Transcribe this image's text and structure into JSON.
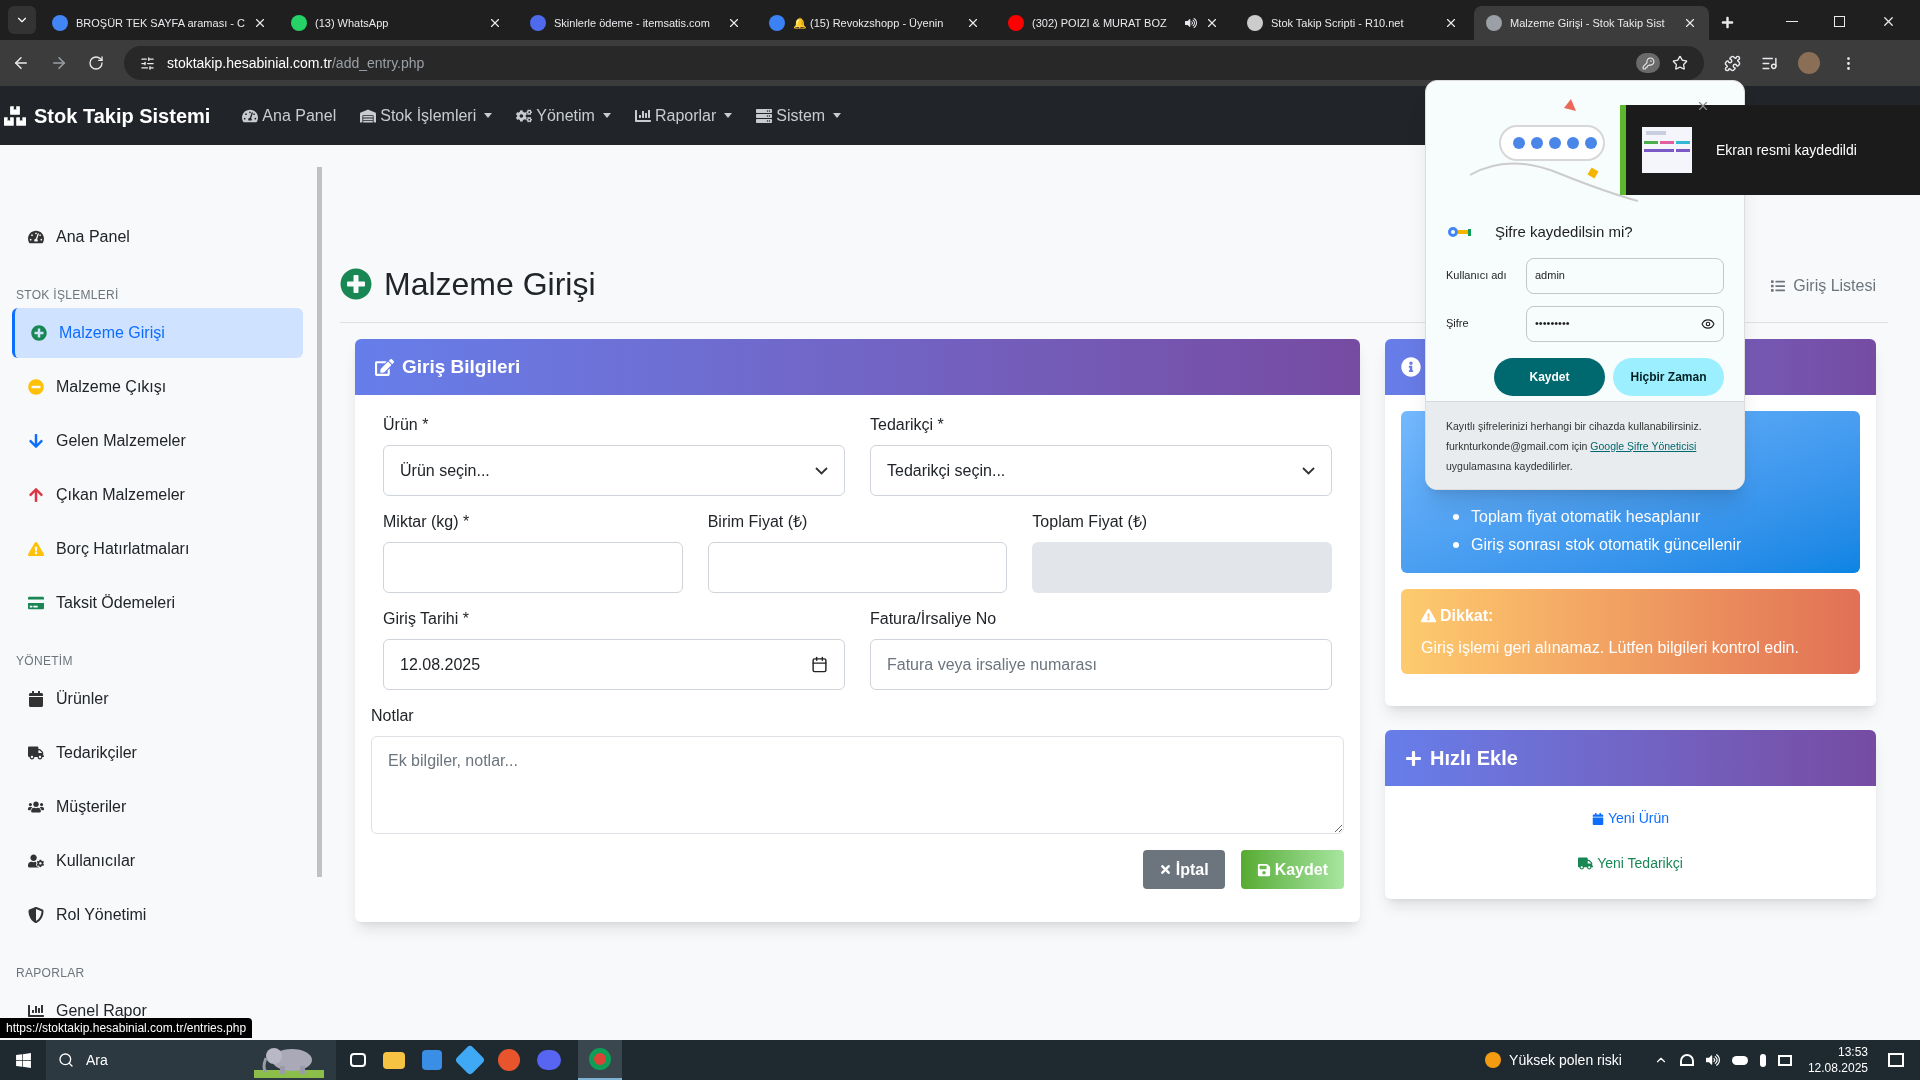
{
  "browser": {
    "tabs": [
      {
        "title": "BROŞÜR TEK SAYFA araması - C",
        "selected": false,
        "audio": false
      },
      {
        "title": "(13) WhatsApp",
        "selected": false,
        "audio": false
      },
      {
        "title": "Skinlerle ödeme - itemsatis.com",
        "selected": false,
        "audio": false
      },
      {
        "title": "🔔 (15) Revokzshopp - Üyenin",
        "selected": false,
        "audio": false
      },
      {
        "title": "(302) POIZI & MURAT BOZ",
        "selected": false,
        "audio": true
      },
      {
        "title": "Stok Takip Scripti - R10.net",
        "selected": false,
        "audio": false
      },
      {
        "title": "Malzeme Girişi - Stok Takip Sist",
        "selected": true,
        "audio": false
      }
    ],
    "url": {
      "host": "stoktakip.hesabinial.com.tr",
      "path": "/add_entry.php"
    }
  },
  "navbar": {
    "brand": "Stok Takip Sistemi",
    "menu": [
      {
        "label": "Ana Panel",
        "dropdown": false
      },
      {
        "label": "Stok İşlemleri",
        "dropdown": true
      },
      {
        "label": "Yönetim",
        "dropdown": true
      },
      {
        "label": "Raporlar",
        "dropdown": true
      },
      {
        "label": "Sistem",
        "dropdown": true
      }
    ]
  },
  "sidebar": {
    "sections": [
      {
        "items": [
          {
            "label": "Ana Panel",
            "selected": false
          }
        ]
      },
      {
        "heading": "STOK İŞLEMLERİ",
        "items": [
          {
            "label": "Malzeme Girişi",
            "selected": true
          },
          {
            "label": "Malzeme Çıkışı",
            "selected": false
          },
          {
            "label": "Gelen Malzemeler",
            "selected": false
          },
          {
            "label": "Çıkan Malzemeler",
            "selected": false
          },
          {
            "label": "Borç Hatırlatmaları",
            "selected": false
          },
          {
            "label": "Taksit Ödemeleri",
            "selected": false
          }
        ]
      },
      {
        "heading": "YÖNETİM",
        "items": [
          {
            "label": "Ürünler",
            "selected": false
          },
          {
            "label": "Tedarikçiler",
            "selected": false
          },
          {
            "label": "Müşteriler",
            "selected": false
          },
          {
            "label": "Kullanıcılar",
            "selected": false
          },
          {
            "label": "Rol Yönetimi",
            "selected": false
          }
        ]
      },
      {
        "heading": "RAPORLAR",
        "items": [
          {
            "label": "Genel Rapor",
            "selected": false
          }
        ]
      }
    ]
  },
  "page": {
    "title": "Malzeme Girişi",
    "list_link": "Giriş Listesi"
  },
  "form": {
    "title": "Giriş Bilgileri",
    "rows": [
      [
        {
          "kind": "select",
          "label": "Ürün *",
          "placeholder": "Ürün seçin...",
          "disabled": false
        },
        {
          "kind": "select",
          "label": "Tedarikçi *",
          "placeholder": "Tedarikçi seçin...",
          "disabled": false
        }
      ],
      [
        {
          "kind": "text",
          "label": "Miktar (kg) *",
          "disabled": false
        },
        {
          "kind": "text",
          "label": "Birim Fiyat (₺)",
          "disabled": false
        },
        {
          "kind": "text",
          "label": "Toplam Fiyat (₺)",
          "disabled": true
        }
      ],
      [
        {
          "kind": "date",
          "label": "Giriş Tarihi *",
          "value": "12.08.2025",
          "disabled": false
        },
        {
          "kind": "text",
          "label": "Fatura/İrsaliye No",
          "placeholder": "Fatura veya irsaliye numarası",
          "disabled": false
        }
      ]
    ],
    "notes": {
      "label": "Notlar",
      "placeholder": "Ek bilgiler, notlar..."
    },
    "buttons": [
      {
        "kind": "cancel",
        "label": "İptal"
      },
      {
        "kind": "save",
        "label": "Kaydet"
      }
    ]
  },
  "info_card": {
    "tips": [
      "Toplam fiyat otomatik hesaplanır",
      "Giriş sonrası stok otomatik güncellenir"
    ],
    "warning": {
      "title": "Dikkat:",
      "text": "Giriş işlemi geri alınamaz. Lütfen bilgileri kontrol edin."
    }
  },
  "quick_add": {
    "title": "Hızlı Ekle",
    "links": [
      {
        "kind": "product",
        "label": "Yeni Ürün"
      },
      {
        "kind": "supplier",
        "label": "Yeni Tedarikçi"
      }
    ]
  },
  "password_prompt": {
    "title": "Şifre kaydedilsin mi?",
    "username_label": "Kullanıcı adı",
    "username": "admin",
    "password_label": "Şifre",
    "password": "•••••••••",
    "save": "Kaydet",
    "never": "Hiçbir Zaman",
    "footer": "Kayıtlı şifrelerinizi herhangi bir cihazda kullanabilirsiniz. furknturkonde@gmail.com için",
    "footer_link": "Google Şifre Yöneticisi",
    "footer_end": "uygulamasına kaydedilirler."
  },
  "toast": {
    "text": "Ekran resmi kaydedildi"
  },
  "status_url": "https://stoktakip.hesabinial.com.tr/entries.php",
  "taskbar": {
    "search": "Ara",
    "weather": "Yüksek polen riski",
    "time": "13:53",
    "date": "12.08.2025"
  }
}
